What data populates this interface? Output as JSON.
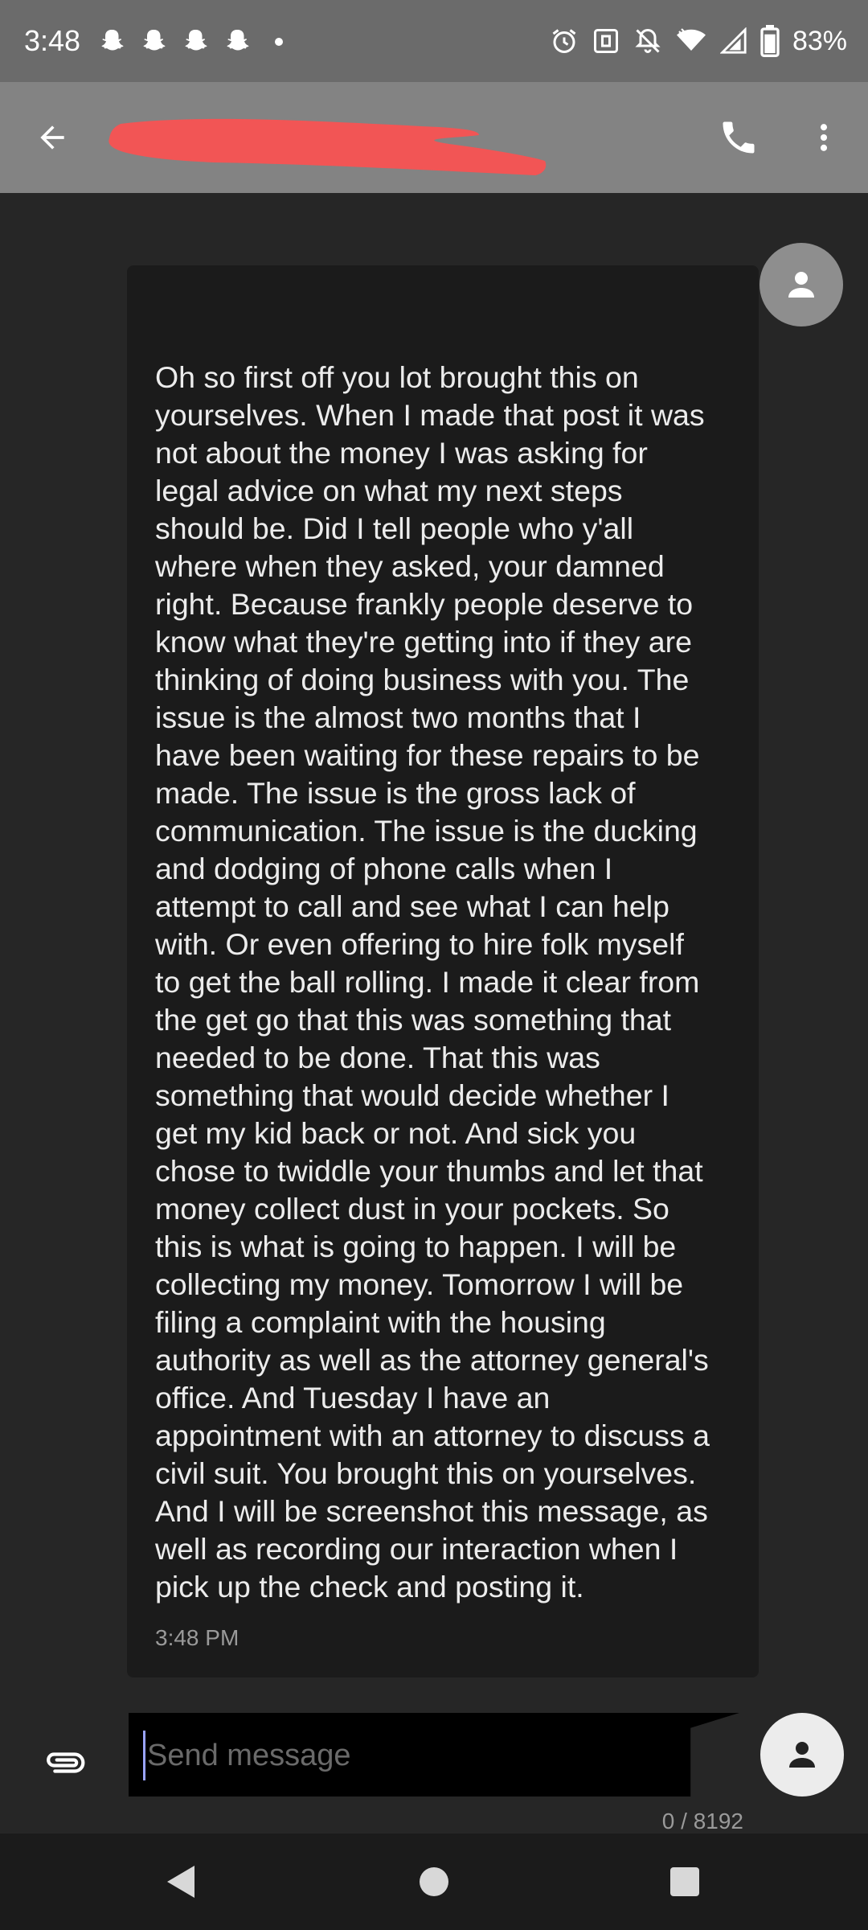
{
  "status_bar": {
    "time": "3:48",
    "notification_icons": [
      "snapchat-icon",
      "snapchat-icon",
      "snapchat-icon",
      "snapchat-icon",
      "more-notifications-dot"
    ],
    "system_icons": [
      "alarm-icon",
      "nfc-icon",
      "notifications-off-icon",
      "wifi-icon",
      "signal-icon",
      "battery-icon"
    ],
    "battery_percent": "83%"
  },
  "app_bar": {
    "back_icon": "arrow-back-icon",
    "contact_name_redacted": true,
    "call_icon": "phone-icon",
    "menu_icon": "more-vert-icon",
    "background": "#838383"
  },
  "conversation": {
    "messages": [
      {
        "sender": "contact",
        "text": "Oh so first off you lot brought this on yourselves. When I made that post it was not about the money I was asking for legal advice on what my next steps should be. Did I tell people who y'all where when they asked, your damned right. Because frankly people deserve to know what they're getting into if they are thinking of doing business with you. The issue is the almost two months that I have been waiting for these repairs to be made. The issue is the gross lack of communication. The issue is the ducking and dodging of phone calls when I attempt to call and see what I can help with. Or even offering to hire folk myself to get the ball rolling. I made it clear from the get go that this was something that needed to be done. That this was something that would decide whether I get my kid back or not. And sick you chose to twiddle your thumbs and let that money collect dust in your pockets. So this is what is going to happen. I will be collecting my money. Tomorrow I will be filing a complaint with the housing authority as well as the attorney general's office. And Tuesday I have an appointment with an attorney to discuss a civil suit. You brought this on yourselves. And I will be screenshot this message, as well as recording our interaction when I pick up the check and posting it.",
        "time": "3:48 PM"
      }
    ],
    "bubble_color": "#1b1b1b",
    "background": "#262626"
  },
  "compose": {
    "attach_icon": "attachment-icon",
    "placeholder": "Send message",
    "value": "",
    "char_counter": "0 / 8192",
    "avatar_icon": "person-icon"
  },
  "nav_bar": {
    "back_icon": "nav-back-icon",
    "home_icon": "nav-home-icon",
    "recents_icon": "nav-recents-icon"
  }
}
